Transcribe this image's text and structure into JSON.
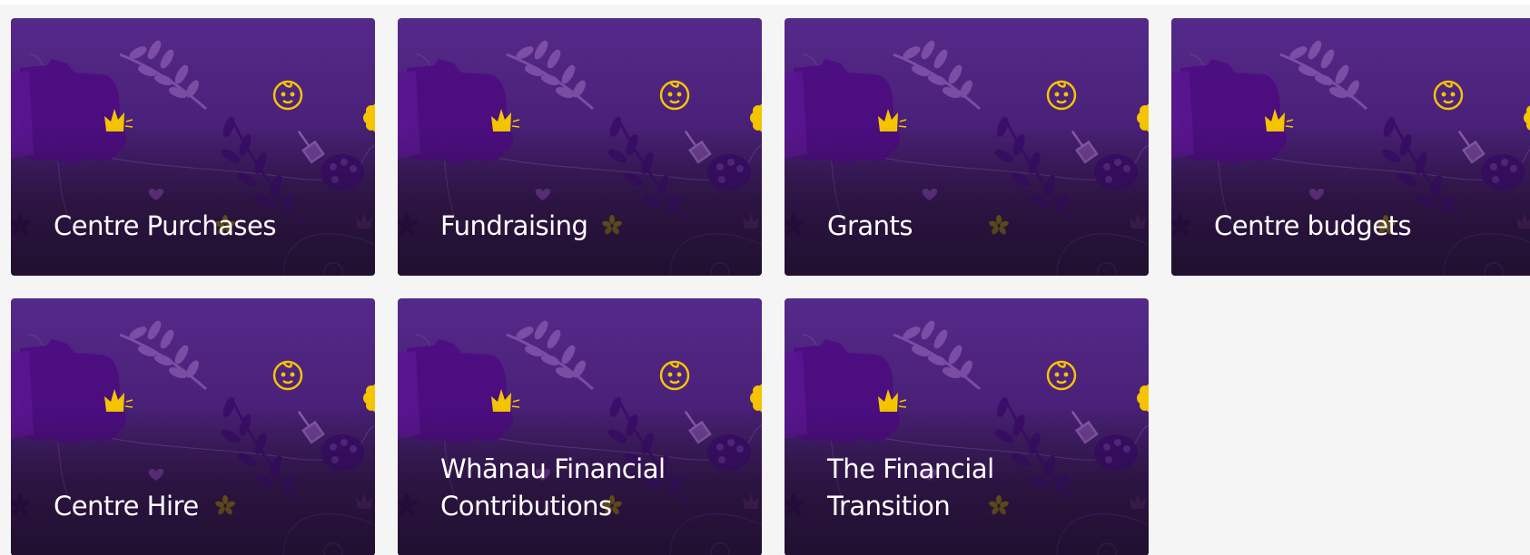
{
  "cards": [
    {
      "title": "Centre Purchases"
    },
    {
      "title": "Fundraising"
    },
    {
      "title": "Grants"
    },
    {
      "title": "Centre budgets"
    },
    {
      "title": "Centre Hire"
    },
    {
      "title": "Whānau Financial Contributions"
    },
    {
      "title": "The Financial Transition"
    }
  ],
  "colors": {
    "card_purple": "#55298a",
    "card_dark": "#29153c",
    "accent_yellow": "#f5c400",
    "page_bg": "#f5f5f5",
    "title_text": "#ffffff"
  },
  "icons": [
    "baby-face-icon",
    "crown-icon",
    "paint-palette-icon",
    "trowel-icon",
    "leaf-branch-icon",
    "star-flower-icon",
    "heart-icon",
    "bucket-icon"
  ]
}
